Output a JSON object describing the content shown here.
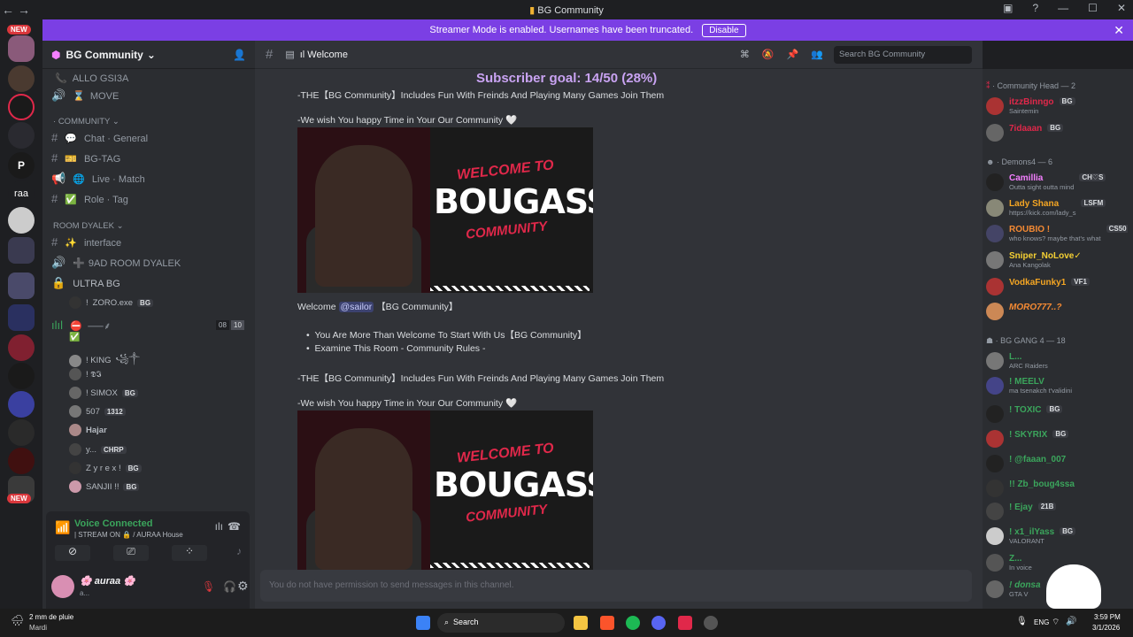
{
  "window": {
    "title": "BG Community",
    "back": "←",
    "forward": "→"
  },
  "banner": {
    "text": "Streamer Mode is enabled. Usernames have been truncated.",
    "button": "Disable"
  },
  "guilds": {
    "new_top": "NEW",
    "new_bottom": "NEW",
    "raa": "raa"
  },
  "server": {
    "name": "BG Community"
  },
  "channels": [
    {
      "label": "ALLO GSI3A",
      "icon": "📞"
    },
    {
      "label": "MOVE",
      "icon": "⌛"
    },
    {
      "label": "COMMUNITY",
      "type": "category"
    },
    {
      "label": "Chat · General",
      "icon": "💬"
    },
    {
      "label": "BG-TAG",
      "icon": "🎫"
    },
    {
      "label": "Live · Match",
      "icon": "🌐"
    },
    {
      "label": "Role · Tag",
      "icon": "✅"
    },
    {
      "label": "ROOM DYALEK",
      "type": "category"
    },
    {
      "label": "interface",
      "icon": "✨"
    },
    {
      "label": "9AD ROOM DYALEK",
      "icon": "➕"
    },
    {
      "label": "ULTRA BG",
      "icon": "🔒"
    }
  ],
  "voice_users_a": [
    {
      "name": "ZORO.exe",
      "tag": "BG"
    }
  ],
  "voice_channel_b": {
    "label": "⸺⸙",
    "count_a": "08",
    "count_b": "10"
  },
  "voice_users_b": [
    {
      "name": "! KING",
      "extra": "꧁༒"
    },
    {
      "name": "! 𝕯𝕴"
    },
    {
      "name": "! SIMOX",
      "tag": "BG"
    },
    {
      "name": "507",
      "tag": "1312"
    },
    {
      "name": "Hajar"
    },
    {
      "name": "y...",
      "tag": "CHRP"
    },
    {
      "name": "Z y r e x !",
      "tag": "BG"
    },
    {
      "name": "SANJII !!",
      "tag": "BG"
    }
  ],
  "voice": {
    "status": "Voice Connected",
    "detail": "| STREAM ON 🔒 / AURAA House"
  },
  "user": {
    "name": "🌸 auraa 🌸",
    "sub": "a..."
  },
  "channel_bar": {
    "name": "ıl Welcome",
    "search_placeholder": "Search BG Community"
  },
  "messages": {
    "goal": "Subscriber goal: 14/50 (28%)",
    "line1": "-THE【BG Community】Includes Fun With Freinds And Playing Many Games Join Them",
    "line2": "-We wish You happy Time in Your Our Community 🤍",
    "welcome_pre": "Welcome",
    "mention": "@sailor",
    "welcome_post": "【BG Community】",
    "bullet1": "You Are More Than Welcome To Start With Us【BG Community】",
    "bullet2": "Examine This Room      -      Community Rules    -",
    "line3": "-THE【BG Community】Includes Fun With Freinds And Playing Many Games Join Them",
    "line4": "-We wish You happy Time in Your Our Community 🤍",
    "image_title_top": "WELCOME TO",
    "image_title_main": "BOUGASSAA",
    "image_title_bottom": "COMMUNITY",
    "composer": "You do not have permission to send messages in this channel."
  },
  "members": {
    "group1": "Community Head — 2",
    "group2": "Demons4 — 6",
    "group3": "BG GANG 4 — 18",
    "list1": [
      {
        "name": "itzzBinngo",
        "status": "Saintemin",
        "color": "#e0284a",
        "tag": "BG"
      },
      {
        "name": "7idaaan",
        "status": "",
        "color": "#e0284a",
        "tag": "BG"
      }
    ],
    "list2": [
      {
        "name": "Camillia",
        "status": "Outta sight outta mind",
        "color": "#f47fff",
        "tag": "CH♡S"
      },
      {
        "name": "Lady Shana",
        "status": "https://kick.com/lady_s",
        "color": "#f5a623",
        "tag": "LSFM"
      },
      {
        "name": "ROUBIO !",
        "status": "who knows? maybe that's what",
        "color": "#f58a33",
        "tag": "CS50"
      },
      {
        "name": "Sniper_NoLove✓",
        "status": "Ana Kangolak",
        "color": "#f5d033",
        "tag": ""
      },
      {
        "name": "VodkaFunky1",
        "status": "",
        "color": "#f5a623",
        "tag": "VF1"
      },
      {
        "name": "MORO777..?",
        "status": "",
        "color": "#f58a33",
        "tag": ""
      }
    ],
    "list3": [
      {
        "name": "L...",
        "status": "ARC Raiders",
        "color": "#3ba55c",
        "tag": ""
      },
      {
        "name": "! MEELV",
        "status": "ma tsenakch t'validini",
        "color": "#3ba55c",
        "tag": ""
      },
      {
        "name": "! TOXIC",
        "status": "",
        "color": "#3ba55c",
        "tag": "BG"
      },
      {
        "name": "! SKYRIX",
        "status": "",
        "color": "#3ba55c",
        "tag": "BG"
      },
      {
        "name": "! @faaan_007",
        "status": "",
        "color": "#3ba55c",
        "tag": ""
      },
      {
        "name": "!! Zb_boug4ssa",
        "status": "",
        "color": "#3ba55c",
        "tag": ""
      },
      {
        "name": "! Ejay",
        "status": "",
        "color": "#3ba55c",
        "tag": "21B"
      },
      {
        "name": "! x1_ilYass",
        "status": "VALORANT",
        "color": "#3ba55c",
        "tag": "BG"
      },
      {
        "name": "Z...",
        "status": "In voice",
        "color": "#3ba55c",
        "tag": ""
      },
      {
        "name": "! donsa",
        "status": "GTA V",
        "color": "#3ba55c",
        "tag": "BG"
      }
    ]
  },
  "taskbar": {
    "weather": "2 mm de pluie",
    "weather_sub": "Mardi",
    "search": "Search",
    "lang": "ENG",
    "time": "3:59 PM",
    "date": "3/1/2026"
  }
}
